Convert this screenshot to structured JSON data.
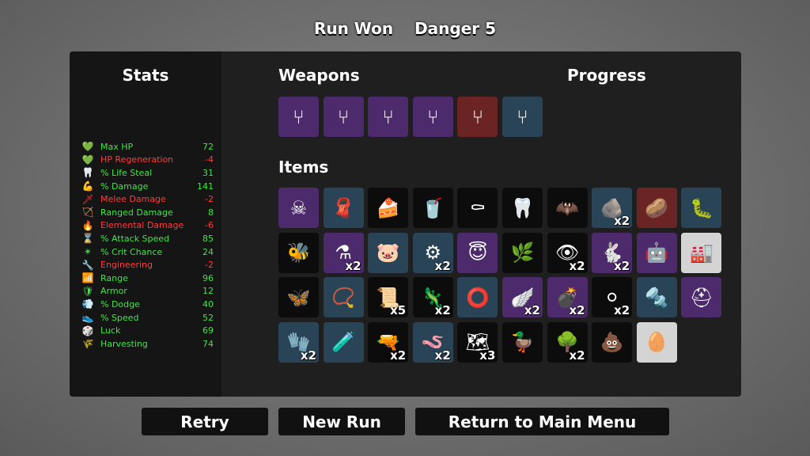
{
  "header": {
    "status": "Run Won",
    "danger": "Danger 5"
  },
  "stats": {
    "title": "Stats",
    "rows": [
      {
        "icon": "heart-icon",
        "glyph": "💚",
        "label": "Max HP",
        "value": "72",
        "tone": "pos"
      },
      {
        "icon": "heart-regen-icon",
        "glyph": "💚",
        "label": "HP Regeneration",
        "value": "-4",
        "tone": "neg"
      },
      {
        "icon": "fangs-icon",
        "glyph": "🦷",
        "label": "% Life Steal",
        "value": "31",
        "tone": "pos"
      },
      {
        "icon": "muscle-icon",
        "glyph": "💪",
        "label": "% Damage",
        "value": "141",
        "tone": "pos"
      },
      {
        "icon": "sword-icon",
        "glyph": "🗡",
        "label": "Melee Damage",
        "value": "-2",
        "tone": "neg"
      },
      {
        "icon": "crossbow-icon",
        "glyph": "🏹",
        "label": "Ranged Damage",
        "value": "8",
        "tone": "pos"
      },
      {
        "icon": "flame-icon",
        "glyph": "🔥",
        "label": "Elemental Damage",
        "value": "-6",
        "tone": "neg"
      },
      {
        "icon": "hourglass-icon",
        "glyph": "⌛",
        "label": "% Attack Speed",
        "value": "85",
        "tone": "pos"
      },
      {
        "icon": "crit-icon",
        "glyph": "✴",
        "label": "% Crit Chance",
        "value": "24",
        "tone": "pos"
      },
      {
        "icon": "wrench-icon",
        "glyph": "🔧",
        "label": "Engineering",
        "value": "-2",
        "tone": "neg"
      },
      {
        "icon": "range-icon",
        "glyph": "📶",
        "label": "Range",
        "value": "96",
        "tone": "pos"
      },
      {
        "icon": "shield-icon",
        "glyph": "🛡",
        "label": "Armor",
        "value": "12",
        "tone": "pos"
      },
      {
        "icon": "dodge-icon",
        "glyph": "💨",
        "label": "% Dodge",
        "value": "40",
        "tone": "pos"
      },
      {
        "icon": "boot-icon",
        "glyph": "👟",
        "label": "% Speed",
        "value": "52",
        "tone": "pos"
      },
      {
        "icon": "dice-icon",
        "glyph": "🎲",
        "label": "Luck",
        "value": "69",
        "tone": "pos"
      },
      {
        "icon": "wheat-icon",
        "glyph": "🌾",
        "label": "Harvesting",
        "value": "74",
        "tone": "pos"
      }
    ]
  },
  "weapons": {
    "title": "Weapons",
    "slots": [
      {
        "icon": "slingshot-icon",
        "glyph": "⑂",
        "tier": "t3"
      },
      {
        "icon": "slingshot-icon",
        "glyph": "⑂",
        "tier": "t3"
      },
      {
        "icon": "slingshot-icon",
        "glyph": "⑂",
        "tier": "t3"
      },
      {
        "icon": "slingshot-icon",
        "glyph": "⑂",
        "tier": "t3"
      },
      {
        "icon": "slingshot-icon",
        "glyph": "⑂",
        "tier": "t4"
      },
      {
        "icon": "slingshot-icon",
        "glyph": "⑂",
        "tier": "t2"
      }
    ]
  },
  "progress": {
    "title": "Progress"
  },
  "items": {
    "title": "Items",
    "slots": [
      {
        "icon": "skull-bird-icon",
        "glyph": "☠",
        "tier": "t3",
        "count": ""
      },
      {
        "icon": "scarf-icon",
        "glyph": "🧣",
        "tier": "t2",
        "count": ""
      },
      {
        "icon": "cake-icon",
        "glyph": "🍰",
        "tier": "t1",
        "count": ""
      },
      {
        "icon": "cup-icon",
        "glyph": "🥤",
        "tier": "t1",
        "count": ""
      },
      {
        "icon": "scythe-icon",
        "glyph": "⚰",
        "tier": "t1",
        "count": ""
      },
      {
        "icon": "fang-icon",
        "glyph": "🦷",
        "tier": "t1",
        "count": ""
      },
      {
        "icon": "gargoyle-icon",
        "glyph": "🦇",
        "tier": "t1",
        "count": ""
      },
      {
        "icon": "stone-icon",
        "glyph": "🪨",
        "tier": "t2",
        "count": "x2"
      },
      {
        "icon": "potato-icon",
        "glyph": "🥔",
        "tier": "t4",
        "count": ""
      },
      {
        "icon": "larva-icon",
        "glyph": "🐛",
        "tier": "t2",
        "count": ""
      },
      {
        "icon": "bee-icon",
        "glyph": "🐝",
        "tier": "t1",
        "count": ""
      },
      {
        "icon": "mortar-icon",
        "glyph": "⚗",
        "tier": "t3",
        "count": "x2"
      },
      {
        "icon": "piggy-bank-icon",
        "glyph": "🐷",
        "tier": "t2",
        "count": ""
      },
      {
        "icon": "turret-icon",
        "glyph": "⚙",
        "tier": "t2",
        "count": "x2"
      },
      {
        "icon": "halo-icon",
        "glyph": "😇",
        "tier": "t3",
        "count": ""
      },
      {
        "icon": "plant-icon",
        "glyph": "🌿",
        "tier": "t1",
        "count": ""
      },
      {
        "icon": "cyclops-icon",
        "glyph": "👁",
        "tier": "t1",
        "count": "x2"
      },
      {
        "icon": "rabbit-icon",
        "glyph": "🐇",
        "tier": "t3",
        "count": "x2"
      },
      {
        "icon": "robot-arm-icon",
        "glyph": "🤖",
        "tier": "t3",
        "count": ""
      },
      {
        "icon": "machine-icon",
        "glyph": "🏭",
        "tier": "t0",
        "count": ""
      },
      {
        "icon": "butterfly-icon",
        "glyph": "🦋",
        "tier": "t1",
        "count": ""
      },
      {
        "icon": "pendant-icon",
        "glyph": "📿",
        "tier": "t2",
        "count": ""
      },
      {
        "icon": "scroll-icon",
        "glyph": "📜",
        "tier": "t1",
        "count": "x5"
      },
      {
        "icon": "lizard-icon",
        "glyph": "🦎",
        "tier": "t1",
        "count": "x2"
      },
      {
        "icon": "ring-icon",
        "glyph": "⭕",
        "tier": "t2",
        "count": ""
      },
      {
        "icon": "wings-icon",
        "glyph": "🪽",
        "tier": "t3",
        "count": "x2"
      },
      {
        "icon": "grenade-icon",
        "glyph": "💣",
        "tier": "t3",
        "count": "x2"
      },
      {
        "icon": "pearls-icon",
        "glyph": "⚪",
        "tier": "t1",
        "count": "x2"
      },
      {
        "icon": "crank-icon",
        "glyph": "🔩",
        "tier": "t2",
        "count": ""
      },
      {
        "icon": "helmet-icon",
        "glyph": "⛑",
        "tier": "t3",
        "count": ""
      },
      {
        "icon": "glove-icon",
        "glyph": "🧤",
        "tier": "t2",
        "count": "x2"
      },
      {
        "icon": "potion-icon",
        "glyph": "🧪",
        "tier": "t2",
        "count": ""
      },
      {
        "icon": "shotgun-icon",
        "glyph": "🔫",
        "tier": "t1",
        "count": "x2"
      },
      {
        "icon": "worm-icon",
        "glyph": "🪱",
        "tier": "t2",
        "count": "x2"
      },
      {
        "icon": "treasure-map-icon",
        "glyph": "🗺",
        "tier": "t1",
        "count": "x3"
      },
      {
        "icon": "duck-icon",
        "glyph": "🦆",
        "tier": "t1",
        "count": ""
      },
      {
        "icon": "tree-icon",
        "glyph": "🌳",
        "tier": "t1",
        "count": "x2"
      },
      {
        "icon": "poop-icon",
        "glyph": "💩",
        "tier": "t1",
        "count": ""
      },
      {
        "icon": "egg-icon",
        "glyph": "🥚",
        "tier": "t0",
        "count": ""
      }
    ]
  },
  "buttons": {
    "retry": "Retry",
    "new_run": "New Run",
    "main_menu": "Return to Main Menu"
  }
}
